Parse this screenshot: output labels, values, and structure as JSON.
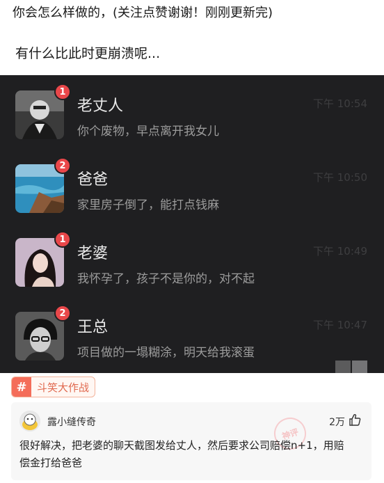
{
  "post": {
    "headline": "你会怎么样做的，(关注点赞谢谢！刚刚更新完)",
    "subline": "有什么比此时更崩溃呢..."
  },
  "chats": [
    {
      "name": "老丈人",
      "badge": "1",
      "preview": "你个废物，早点离开我女儿",
      "time": "下午 10:54"
    },
    {
      "name": "爸爸",
      "badge": "2",
      "preview": "家里房子倒了，能打点钱麻",
      "time": "下午 10:50"
    },
    {
      "name": "老婆",
      "badge": "1",
      "preview": "我怀孕了，孩子不是你的，对不起",
      "time": "下午 10:49"
    },
    {
      "name": "王总",
      "badge": "2",
      "preview": "项目做的一塌糊涂，明天给我滚蛋",
      "time": "下午 10:47"
    }
  ],
  "topic": {
    "hash": "#",
    "label": "斗笑大作战"
  },
  "comment": {
    "user": "露小缝传奇",
    "likes": "2万",
    "text": "很好解决，把老婆的聊天截图发给丈人，然后要求公司赔偿n+1，用赔偿金打给爸爸",
    "stamp": "神评"
  },
  "colors": {
    "badge": "#e9474a",
    "tag_accent": "#f46d5a",
    "chat_bg": "#1f1f21"
  }
}
